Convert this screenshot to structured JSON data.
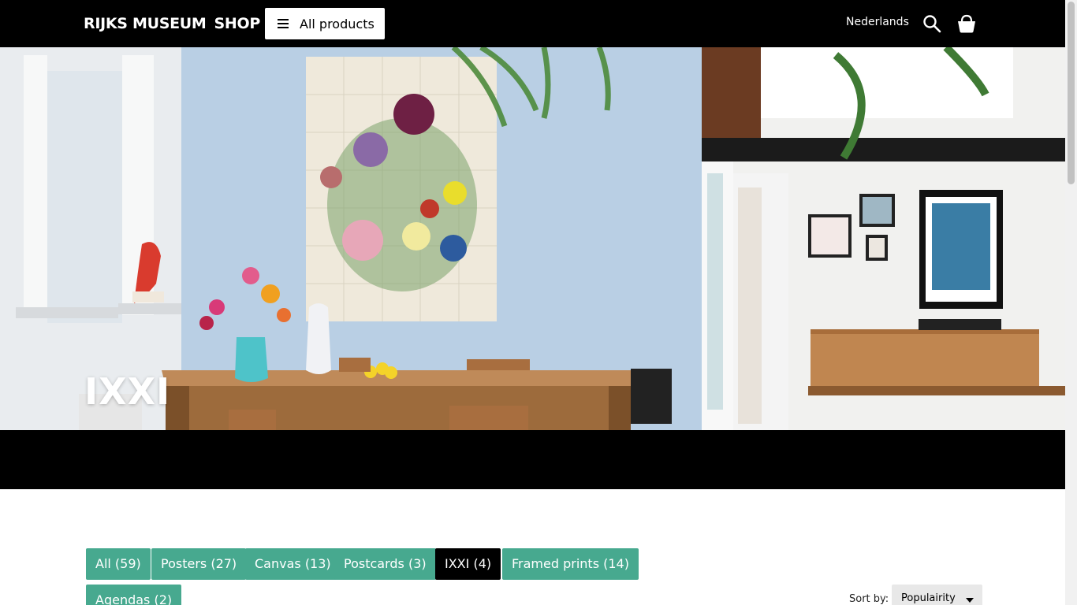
{
  "header": {
    "logo_text": "RIJKS MUSEUM",
    "logo_shop": "SHOP",
    "all_products_label": "All products",
    "language_label": "Nederlands",
    "search_icon": "search-icon",
    "cart_icon": "shopping-bag-icon"
  },
  "hero": {
    "title": "IXXI"
  },
  "filters": [
    {
      "label": "All (59)",
      "active": false
    },
    {
      "label": "Posters (27)",
      "active": false
    },
    {
      "label": "Canvas (13)",
      "active": false
    },
    {
      "label": "Postcards (3)",
      "active": false
    },
    {
      "label": "IXXI (4)",
      "active": true
    },
    {
      "label": "Framed prints (14)",
      "active": false
    },
    {
      "label": "Agendas (2)",
      "active": false
    }
  ],
  "sort": {
    "label": "Sort by:",
    "selected": "Populairity"
  },
  "colors": {
    "accent": "#47a98f",
    "active_chip": "#000000",
    "topbar": "#000000"
  }
}
